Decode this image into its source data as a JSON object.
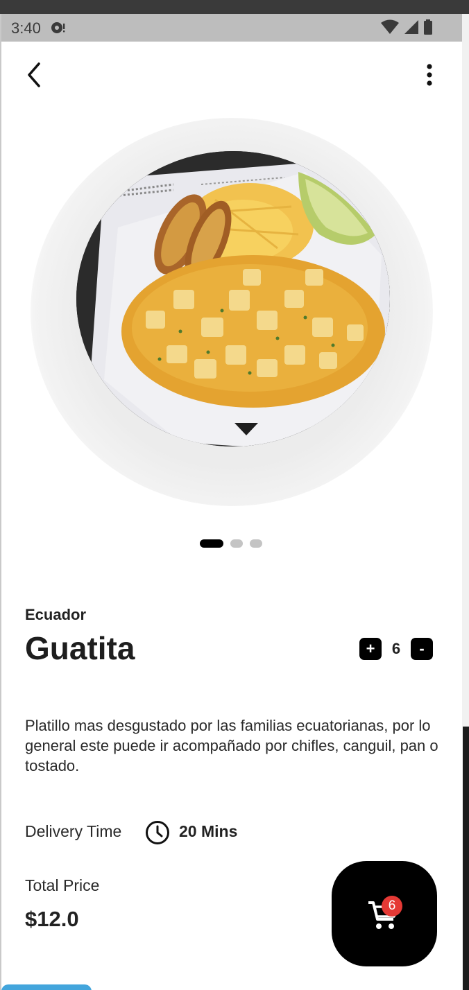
{
  "status_bar": {
    "time": "3:40"
  },
  "carousel": {
    "slide_count": 3,
    "active_index": 0
  },
  "product": {
    "origin": "Ecuador",
    "name": "Guatita",
    "quantity": "6",
    "plus_label": "+",
    "minus_label": "-",
    "description": "Platillo mas desgustado por las familias ecuatorianas, por lo general este puede ir acompañado por chifles, canguil, pan o tostado.",
    "delivery_label": "Delivery Time",
    "delivery_value": "20 Mins",
    "total_label": "Total Price",
    "total_value": "$12.0"
  },
  "cart": {
    "badge_count": "6"
  },
  "icons": {
    "back": "arrow-back-icon",
    "menu": "more-vert-icon",
    "clock": "clock-icon",
    "cart": "shopping-cart-icon"
  },
  "colors": {
    "accent": "#000000",
    "badge": "#e53935",
    "background": "#ffffff"
  }
}
